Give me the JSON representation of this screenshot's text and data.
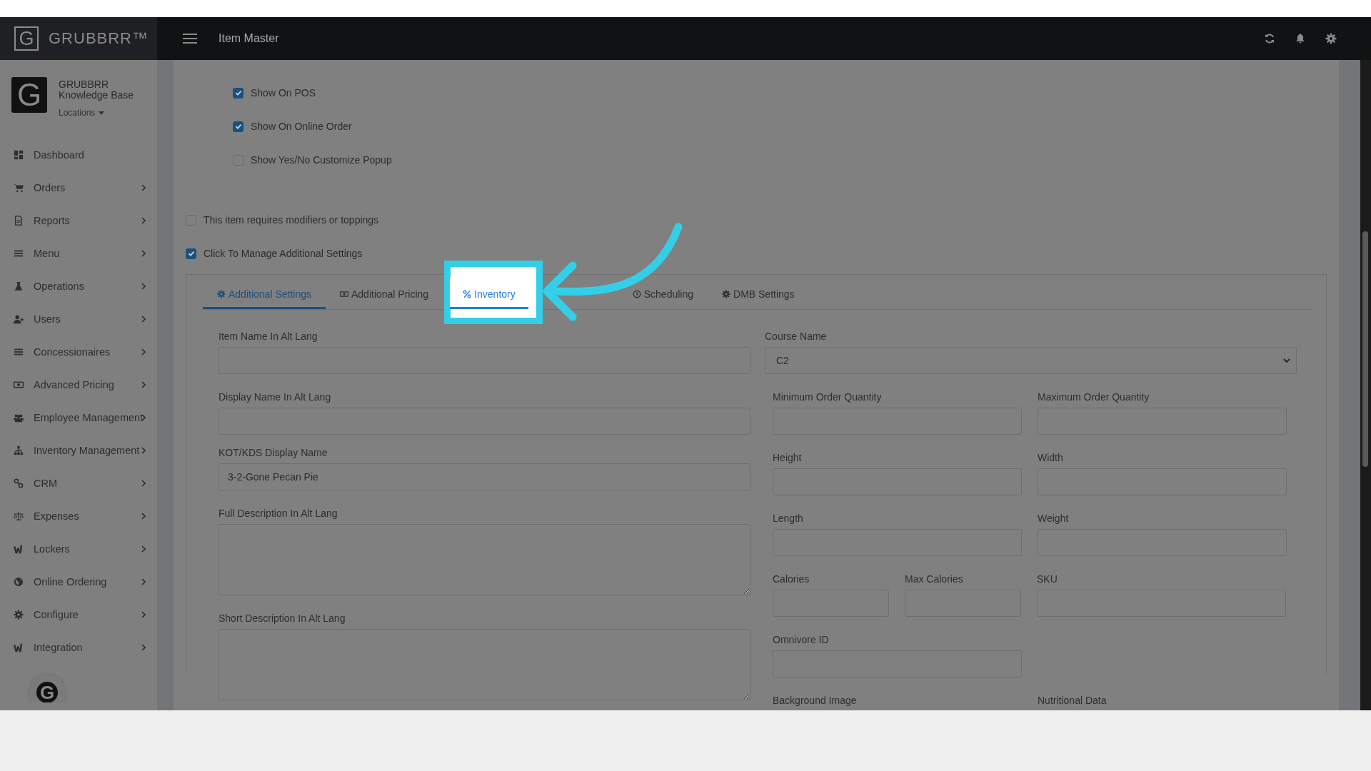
{
  "sidebar": {
    "logo_letter": "G",
    "logo_text": "GRUBBRR™",
    "account": {
      "avatar_letter": "G",
      "name": "GRUBBRR",
      "subtitle": "Knowledge Base",
      "locations": "Locations"
    },
    "items": [
      {
        "label": "Dashboard",
        "has_submenu": false
      },
      {
        "label": "Orders",
        "has_submenu": true
      },
      {
        "label": "Reports",
        "has_submenu": true
      },
      {
        "label": "Menu",
        "has_submenu": true
      },
      {
        "label": "Operations",
        "has_submenu": true
      },
      {
        "label": "Users",
        "has_submenu": true
      },
      {
        "label": "Concessionaires",
        "has_submenu": true
      },
      {
        "label": "Advanced Pricing",
        "has_submenu": true
      },
      {
        "label": "Employee Management",
        "has_submenu": true
      },
      {
        "label": "Inventory Management",
        "has_submenu": true
      },
      {
        "label": "CRM",
        "has_submenu": true
      },
      {
        "label": "Expenses",
        "has_submenu": true
      },
      {
        "label": "Lockers",
        "has_submenu": true
      },
      {
        "label": "Online Ordering",
        "has_submenu": true
      },
      {
        "label": "Configure",
        "has_submenu": true
      },
      {
        "label": "Integration",
        "has_submenu": true
      }
    ],
    "footer_letter": "G"
  },
  "topbar": {
    "title": "Item Master"
  },
  "visibility_options": [
    {
      "label": "Show On POS",
      "checked": true
    },
    {
      "label": "Show On Online Order",
      "checked": true
    },
    {
      "label": "Show Yes/No Customize Popup",
      "checked": false
    }
  ],
  "item_options": [
    {
      "label": "This item requires modifiers or toppings",
      "checked": false
    },
    {
      "label": "Click To Manage Additional Settings",
      "checked": true
    }
  ],
  "tabs": [
    {
      "label": "Additional Settings",
      "selected": true,
      "highlighted": false
    },
    {
      "label": "Additional Pricing",
      "selected": false,
      "highlighted": false
    },
    {
      "label": "Inventory",
      "selected": false,
      "highlighted": true
    },
    {
      "label": "Scheduling",
      "selected": false,
      "highlighted": false
    },
    {
      "label": "DMB Settings",
      "selected": false,
      "highlighted": false
    }
  ],
  "form": {
    "left_fields": [
      {
        "label": "Item Name In Alt Lang",
        "kind": "input"
      },
      {
        "label": "Display Name In Alt Lang",
        "kind": "input"
      },
      {
        "label": "KOT/KDS Display Name",
        "kind": "input",
        "value": "3-2-Gone Pecan Pie"
      },
      {
        "label": "Full Description In Alt Lang",
        "kind": "textarea"
      },
      {
        "label": "Short Description In Alt Lang",
        "kind": "textarea"
      }
    ],
    "course": {
      "label": "Course Name",
      "value": "C2"
    },
    "right_fields": [
      {
        "label": "Minimum Order Quantity",
        "kind": "input"
      },
      {
        "label": "Maximum Order Quantity",
        "kind": "input"
      },
      {
        "label": "Height",
        "kind": "input"
      },
      {
        "label": "Width",
        "kind": "input"
      },
      {
        "label": "Length",
        "kind": "input"
      },
      {
        "label": "Weight",
        "kind": "input"
      },
      {
        "label": "Calories",
        "kind": "half"
      },
      {
        "label": "Max Calories",
        "kind": "half"
      },
      {
        "label": "SKU",
        "kind": "input"
      },
      {
        "label": "Omnivore ID",
        "kind": "input"
      },
      {
        "label": "Background Image",
        "kind": "label"
      },
      {
        "label": "Nutritional Data",
        "kind": "label"
      }
    ]
  }
}
